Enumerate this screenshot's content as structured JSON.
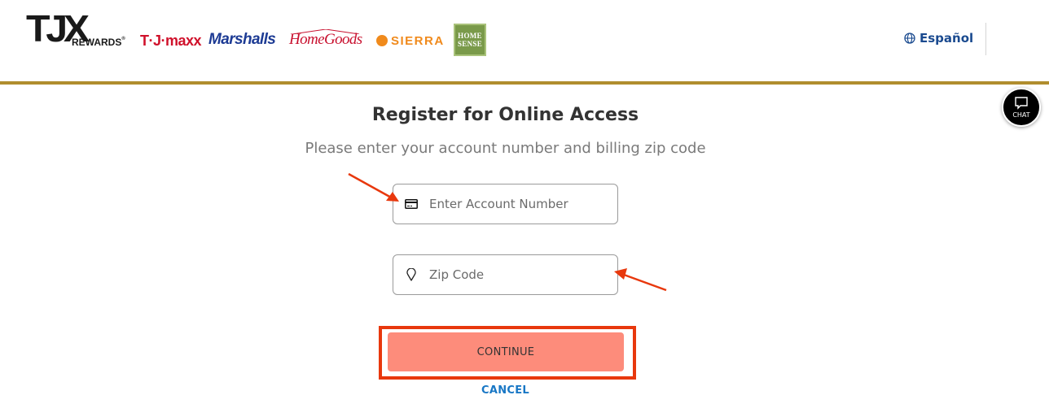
{
  "header": {
    "brand_logos": [
      {
        "name": "TJX Rewards",
        "text": "TJX",
        "subtext": "REWARDS"
      },
      {
        "name": "TJ Maxx",
        "text": "T·J·maxx"
      },
      {
        "name": "Marshalls",
        "text": "Marshalls"
      },
      {
        "name": "HomeGoods",
        "text": "HomeGoods"
      },
      {
        "name": "Sierra",
        "text": "SIERRA"
      },
      {
        "name": "HomeSense",
        "line1": "HOME",
        "line2": "SENSE"
      }
    ],
    "language_link": "Español"
  },
  "chat": {
    "label": "CHAT"
  },
  "main": {
    "title": "Register for Online Access",
    "subtitle": "Please enter your account number and billing zip code",
    "account_field": {
      "placeholder": "Enter Account Number",
      "value": "",
      "icon": "credit-card-icon"
    },
    "zip_field": {
      "placeholder": "Zip Code",
      "value": "",
      "icon": "location-pin-icon"
    },
    "continue_label": "CONTINUE",
    "cancel_label": "CANCEL"
  },
  "colors": {
    "brand_gold": "#b08d2e",
    "link_blue": "#1877c5",
    "button_salmon": "#fd8c7b",
    "annotation_red": "#e8380d"
  }
}
